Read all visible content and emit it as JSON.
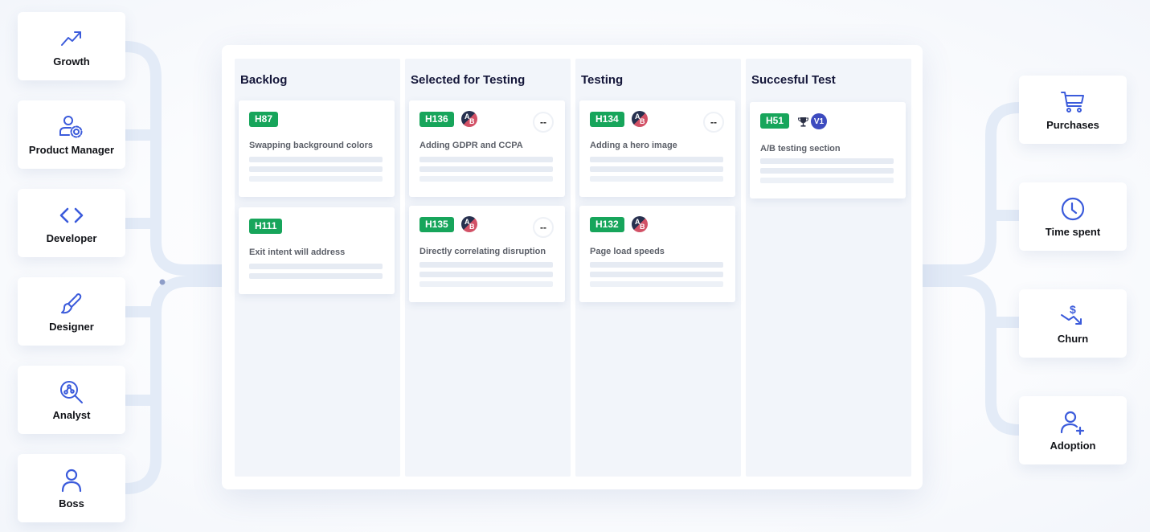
{
  "left_roles": [
    {
      "label": "Growth",
      "icon": "trending-up-icon"
    },
    {
      "label": "Product Manager",
      "icon": "user-gear-icon"
    },
    {
      "label": "Developer",
      "icon": "code-brackets-icon"
    },
    {
      "label": "Designer",
      "icon": "brush-icon"
    },
    {
      "label": "Analyst",
      "icon": "analysis-search-icon"
    },
    {
      "label": "Boss",
      "icon": "user-icon"
    }
  ],
  "right_metrics": [
    {
      "label": "Purchases",
      "icon": "cart-icon"
    },
    {
      "label": "Time spent",
      "icon": "clock-icon"
    },
    {
      "label": "Churn",
      "icon": "dollar-down-icon"
    },
    {
      "label": "Adoption",
      "icon": "user-plus-icon"
    }
  ],
  "board": {
    "columns": [
      {
        "title": "Backlog",
        "cards": [
          {
            "id": "H87",
            "title": "Swapping background colors"
          },
          {
            "id": "H111",
            "title": "Exit intent will address"
          }
        ]
      },
      {
        "title": "Selected for Testing",
        "cards": [
          {
            "id": "H136",
            "title": "Adding GDPR and CCPA",
            "ab_a": "A",
            "ab_b": "B",
            "score": "--"
          },
          {
            "id": "H135",
            "title": "Directly correlating disruption",
            "ab_a": "A",
            "ab_b": "B",
            "score": "--"
          }
        ]
      },
      {
        "title": "Testing",
        "cards": [
          {
            "id": "H134",
            "title": "Adding a hero image",
            "ab_a": "A",
            "ab_b": "B",
            "score": "--"
          },
          {
            "id": "H132",
            "title": "Page load speeds",
            "ab_a": "A",
            "ab_b": "B"
          }
        ]
      },
      {
        "title": "Succesful Test",
        "cards": [
          {
            "id": "H51",
            "title": "A/B testing section",
            "winner": "V1"
          }
        ]
      }
    ]
  },
  "colors": {
    "accent_blue": "#3b5bdb",
    "badge_green": "#17a55b",
    "winner_blue": "#3d4bbf",
    "connector": "#e3ebf7"
  }
}
